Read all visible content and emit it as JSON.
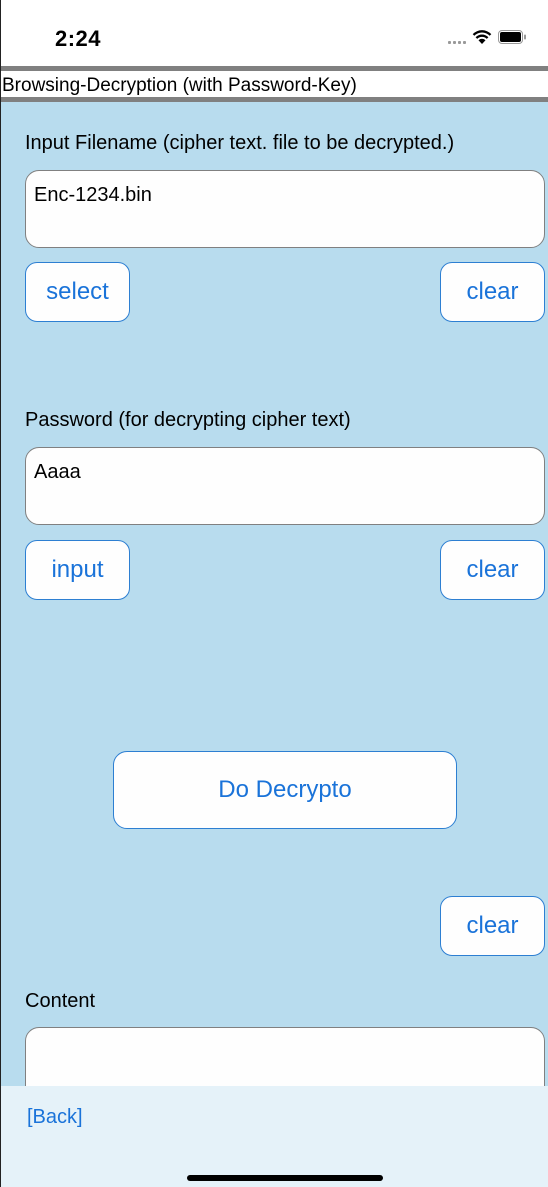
{
  "status_bar": {
    "time": "2:24",
    "icons": [
      "signal-icon",
      "wifi-icon",
      "battery-icon"
    ]
  },
  "header": {
    "title": "Browsing-Decryption (with Password-Key)"
  },
  "input_file": {
    "label": "Input Filename (cipher text. file to be decrypted.)",
    "value": "Enc-1234.bin",
    "select_label": "select",
    "clear_label": "clear"
  },
  "password": {
    "label": "Password (for decrypting cipher text)",
    "value": "Aaaa",
    "input_label": "input",
    "clear_label": "clear"
  },
  "actions": {
    "decrypt_label": "Do Decrypto",
    "clear_label": "clear"
  },
  "content": {
    "label": "Content",
    "value": ""
  },
  "footer": {
    "back_label": "[Back]"
  },
  "colors": {
    "background": "#b8dcee",
    "accent": "#1a73d9",
    "footer_background": "#e5f2f9",
    "title_border": "#808080"
  }
}
